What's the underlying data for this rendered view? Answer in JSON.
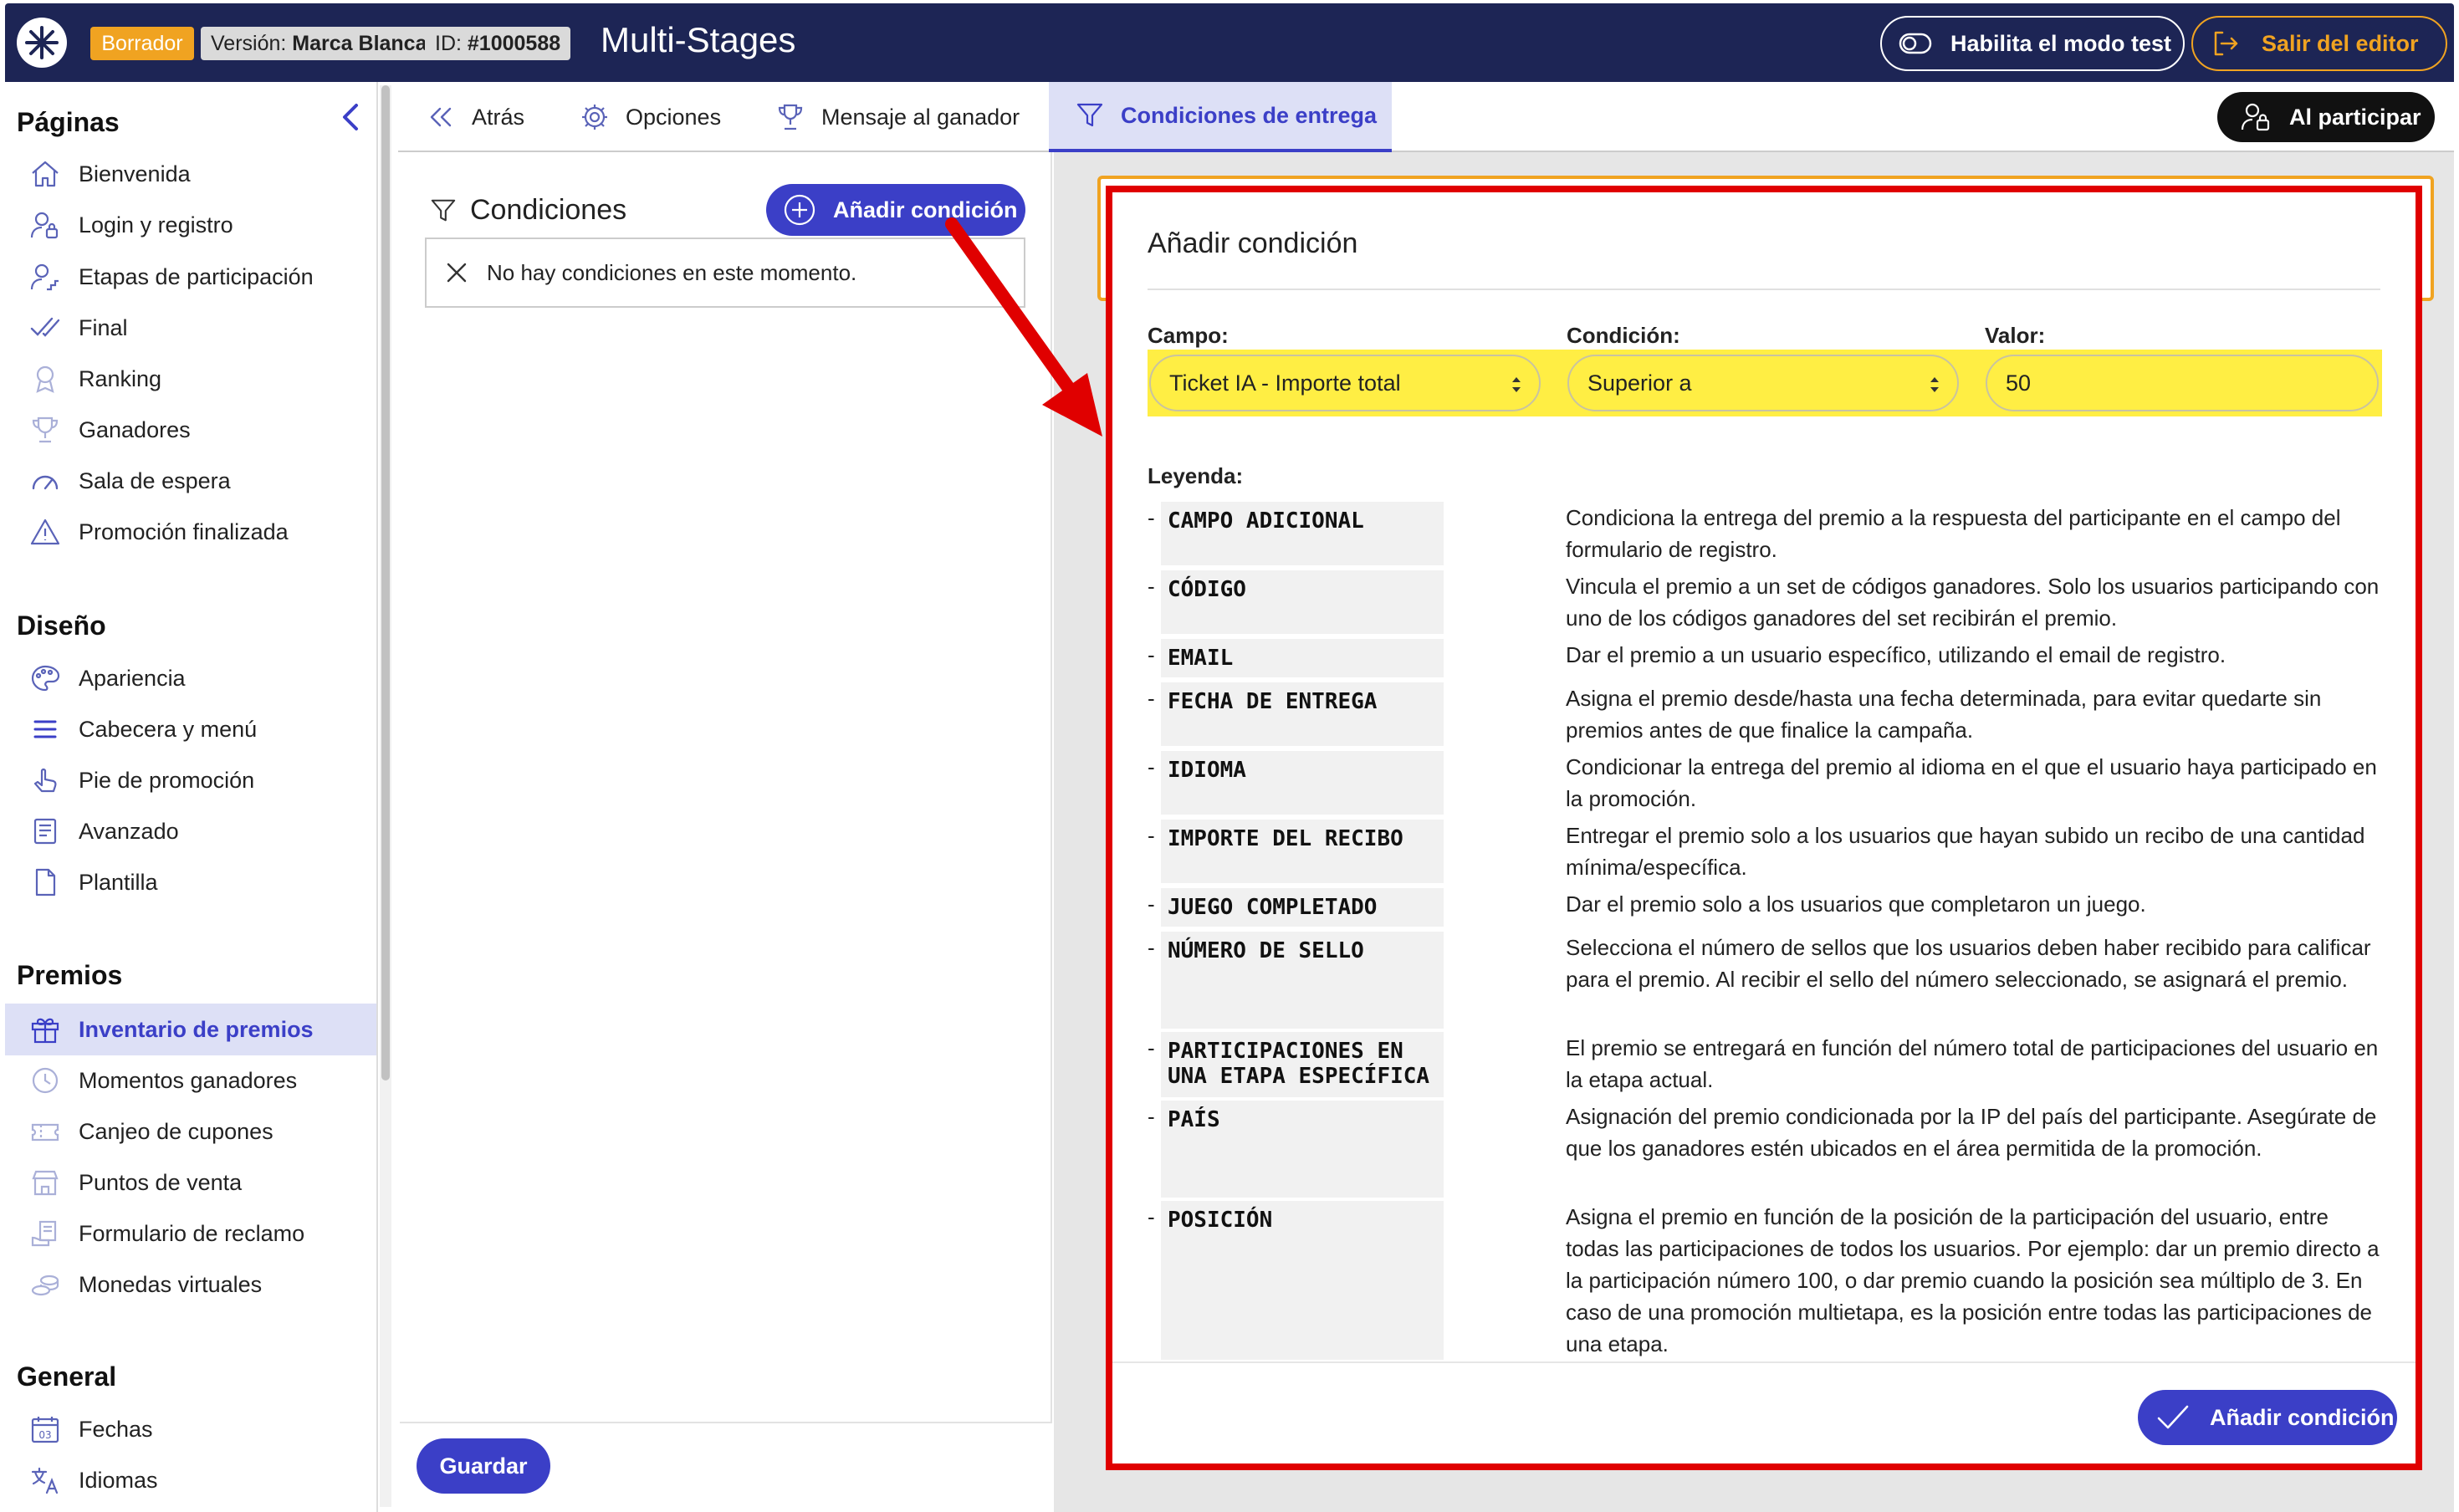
{
  "header": {
    "status_badge": "Borrador",
    "version_label": "Versión:",
    "version_value": "Marca Blanca",
    "id_label": "ID:",
    "id_value": "#1000588",
    "title": "Multi-Stages",
    "test_mode_button": "Habilita el modo test",
    "exit_button": "Salir del editor"
  },
  "sidebar": {
    "sections": [
      {
        "title": "Páginas",
        "items": [
          {
            "label": "Bienvenida",
            "icon": "home-icon"
          },
          {
            "label": "Login y registro",
            "icon": "user-lock-icon"
          },
          {
            "label": "Etapas de participación",
            "icon": "user-steps-icon"
          },
          {
            "label": "Final",
            "icon": "double-check-icon"
          },
          {
            "label": "Ranking",
            "icon": "medal-icon"
          },
          {
            "label": "Ganadores",
            "icon": "trophy-icon"
          },
          {
            "label": "Sala de espera",
            "icon": "speedometer-icon"
          },
          {
            "label": "Promoción finalizada",
            "icon": "warning-icon"
          }
        ]
      },
      {
        "title": "Diseño",
        "items": [
          {
            "label": "Apariencia",
            "icon": "palette-icon"
          },
          {
            "label": "Cabecera y menú",
            "icon": "menu-icon"
          },
          {
            "label": "Pie de promoción",
            "icon": "pointer-hand-icon"
          },
          {
            "label": "Avanzado",
            "icon": "advanced-doc-icon"
          },
          {
            "label": "Plantilla",
            "icon": "document-icon"
          }
        ]
      },
      {
        "title": "Premios",
        "items": [
          {
            "label": "Inventario de premios",
            "icon": "gift-icon",
            "active": true
          },
          {
            "label": "Momentos ganadores",
            "icon": "clock-icon"
          },
          {
            "label": "Canjeo de cupones",
            "icon": "coupon-icon"
          },
          {
            "label": "Puntos de venta",
            "icon": "store-icon"
          },
          {
            "label": "Formulario de reclamo",
            "icon": "claim-form-icon"
          },
          {
            "label": "Monedas virtuales",
            "icon": "coins-icon"
          }
        ]
      },
      {
        "title": "General",
        "items": [
          {
            "label": "Fechas",
            "icon": "calendar-icon"
          },
          {
            "label": "Idiomas",
            "icon": "translate-icon"
          }
        ]
      }
    ]
  },
  "tabs": [
    {
      "label": "Atrás",
      "icon": "double-chevron-left-icon"
    },
    {
      "label": "Opciones",
      "icon": "gear-icon"
    },
    {
      "label": "Mensaje al ganador",
      "icon": "trophy-icon"
    },
    {
      "label": "Condiciones de entrega",
      "icon": "filter-icon",
      "active": true
    }
  ],
  "participate_button": "Al participar",
  "conditions": {
    "title": "Condiciones",
    "add_button": "Añadir condición",
    "empty_message": "No hay condiciones en este momento.",
    "save_button": "Guardar"
  },
  "modal": {
    "title": "Añadir condición",
    "fields": {
      "campo": {
        "label": "Campo:",
        "value": "Ticket IA - Importe total"
      },
      "condicion": {
        "label": "Condición:",
        "value": "Superior a"
      },
      "valor": {
        "label": "Valor:",
        "value": "50"
      }
    },
    "legend_label": "Leyenda:",
    "legend": [
      {
        "key": "CAMPO ADICIONAL",
        "desc": "Condiciona la entrega del premio a la respuesta del participante en el campo del formulario de registro."
      },
      {
        "key": "CÓDIGO",
        "desc": "Vincula el premio a un set de códigos ganadores. Solo los usuarios participando con uno de los códigos ganadores del set recibirán el premio."
      },
      {
        "key": "EMAIL",
        "desc": "Dar el premio a un usuario específico, utilizando el email de registro."
      },
      {
        "key": "FECHA DE ENTREGA",
        "desc": "Asigna el premio desde/hasta una fecha determinada, para evitar quedarte sin premios antes de que finalice la campaña."
      },
      {
        "key": "IDIOMA",
        "desc": "Condicionar la entrega del premio al idioma en el que el usuario haya participado en la promoción."
      },
      {
        "key": "IMPORTE DEL RECIBO",
        "desc": "Entregar el premio solo a los usuarios que hayan subido un recibo de una cantidad mínima/específica."
      },
      {
        "key": "JUEGO COMPLETADO",
        "desc": "Dar el premio solo a los usuarios que completaron un juego."
      },
      {
        "key": "NÚMERO DE SELLO",
        "desc": "Selecciona el número de sellos que los usuarios deben haber recibido para calificar para el premio. Al recibir el sello del número seleccionado, se asignará el premio."
      },
      {
        "key": "PARTICIPACIONES EN UNA ETAPA ESPECÍFICA",
        "desc": "El premio se entregará en función del número total de participaciones del usuario en la etapa actual."
      },
      {
        "key": "PAÍS",
        "desc": "Asignación del premio condicionada por la IP del país del participante. Asegúrate de que los ganadores estén ubicados en el área permitida de la promoción."
      },
      {
        "key": "POSICIÓN",
        "desc": "Asigna el premio en función de la posición de la participación del usuario, entre todas las participaciones de todos los usuarios. Por ejemplo: dar un premio directo a la participación número 100, o dar premio cuando la posición sea múltiplo de 3. En caso de una promoción multietapa, es la posición entre todas las participaciones de una etapa."
      }
    ],
    "submit_button": "Añadir condición"
  },
  "colors": {
    "navy": "#1d2555",
    "accent": "#3b3fc7",
    "orange": "#f0a321",
    "highlight": "#ffee44",
    "annotation_red": "#e00000"
  }
}
